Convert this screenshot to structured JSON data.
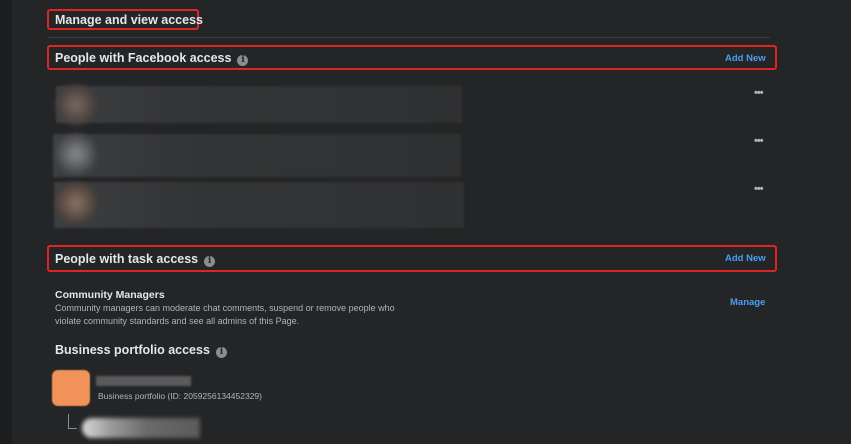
{
  "sections": {
    "manage": {
      "title": "Manage and view access"
    },
    "facebook_access": {
      "title": "People with Facebook access",
      "info_icon": "info-icon",
      "add_new_label": "Add New",
      "rows": [
        {
          "more_label": "•••"
        },
        {
          "more_label": "•••"
        },
        {
          "more_label": "•••"
        }
      ]
    },
    "task_access": {
      "title": "People with task access",
      "info_icon": "info-icon",
      "add_new_label": "Add New",
      "roles": [
        {
          "title": "Community Managers",
          "description": "Community managers can moderate chat comments, suspend or remove people who violate community standards and see all admins of this Page.",
          "action_label": "Manage"
        }
      ]
    },
    "business_portfolio": {
      "title": "Business portfolio access",
      "info_icon": "info-icon",
      "portfolio_id_text": "Business portfolio (ID: 2059256134452329)"
    }
  },
  "colors": {
    "background": "#242526",
    "highlight": "#e02424",
    "link": "#4a9ff5",
    "portfolio_avatar": "#f0925a"
  }
}
